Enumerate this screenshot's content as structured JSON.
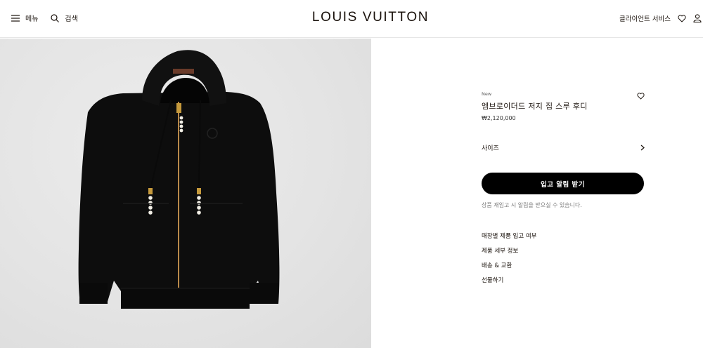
{
  "header": {
    "menu_label": "메뉴",
    "search_label": "검색",
    "logo": "LOUIS VUITTON",
    "client_service_label": "클라이언트 서비스"
  },
  "product": {
    "badge": "New",
    "title": "엠브로이더드 저지 집 스루 후디",
    "price": "₩2,120,000",
    "size_label": "사이즈",
    "notify_button": "입고 알림 받기",
    "notify_note": "상품 재입고 시 알림을 받으실 수 있습니다.",
    "links": [
      "매장별 제품 입고 여부",
      "제품 세부 정보",
      "배송 & 교환",
      "선물하기"
    ]
  },
  "colors": {
    "text": "#19110b",
    "button_bg": "#000000",
    "image_bg": "#e4e4e4"
  }
}
